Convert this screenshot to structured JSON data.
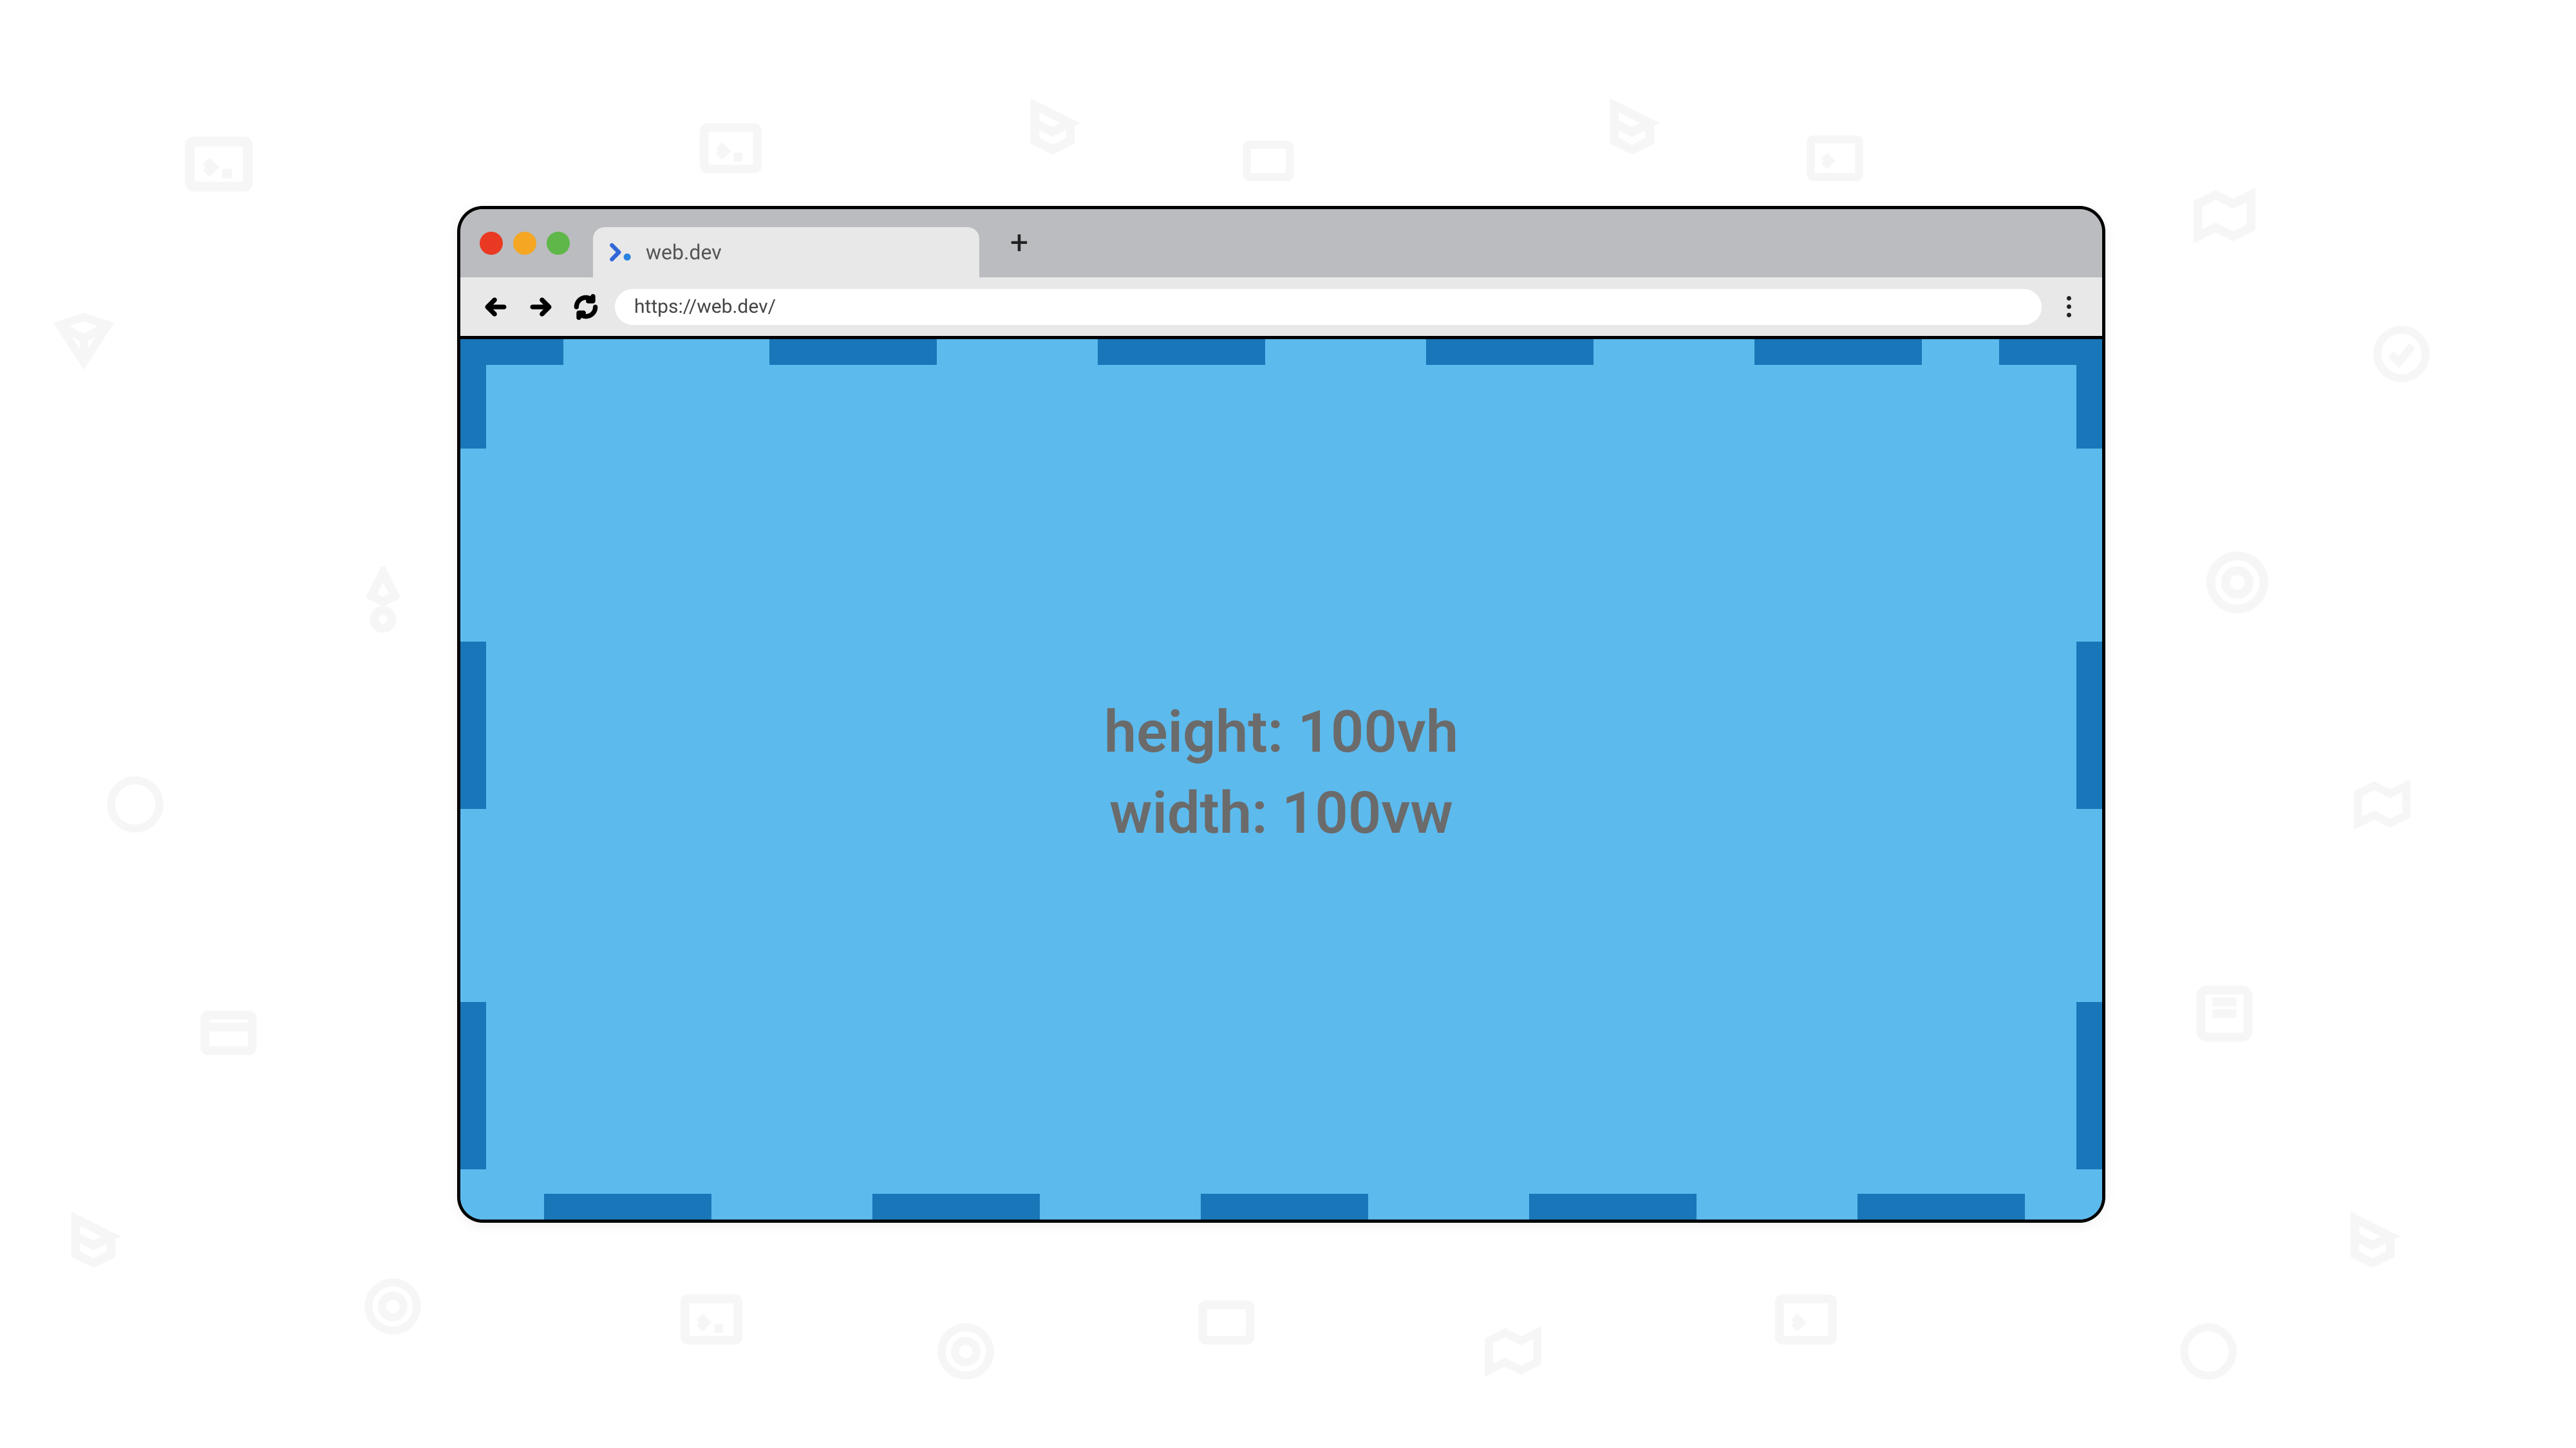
{
  "browser": {
    "tab": {
      "title": "web.dev",
      "favicon_name": "webdev-logo-icon"
    },
    "new_tab_label": "+",
    "address": "https://web.dev/",
    "traffic_lights": {
      "red": "#ea3923",
      "yellow": "#f5a623",
      "green": "#5eb748"
    }
  },
  "viewport": {
    "line1": "height: 100vh",
    "line2": "width: 100vw",
    "bg_color": "#5cbaed",
    "border_color": "#1976b8"
  }
}
